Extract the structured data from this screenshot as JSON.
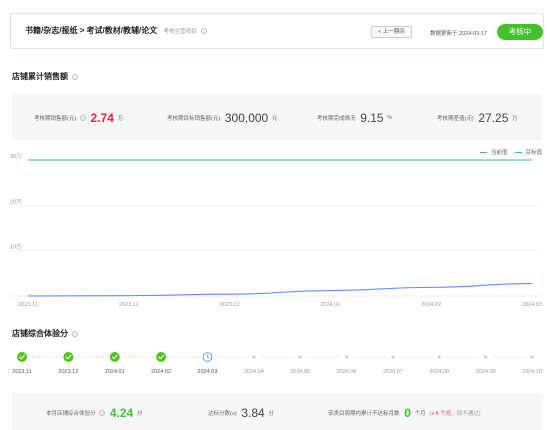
{
  "header": {
    "breadcrumb": "书籍/杂志/报纸 > 考试/教材/教辅/论文",
    "subtitle": "考核主营项目",
    "help_glyph": "?",
    "prev_period": "< 上一期间",
    "update_label": "数据更新于",
    "update_date": "2024-03-17",
    "status": "考核中"
  },
  "sales_section": {
    "title": "店铺累计销售额",
    "kpis": [
      {
        "label": "考核期销售额(元)",
        "value": "2.74",
        "unit": "万"
      },
      {
        "label": "考核期目标销售额(元)",
        "value": "300,000",
        "unit": "元"
      },
      {
        "label": "考核期完成情况",
        "value": "9.15",
        "unit": "%"
      },
      {
        "label": "考核期差值(元)",
        "value": "27.25",
        "unit": "万"
      }
    ],
    "legend": [
      {
        "name": "当前值",
        "color": "#5b8ff9"
      },
      {
        "name": "目标值",
        "color": "#3cc08a"
      }
    ]
  },
  "chart_data": {
    "type": "line",
    "x": [
      "2023.11",
      "2023.11",
      "2023.12",
      "2024.01",
      "2024.02",
      "2024.03"
    ],
    "y_ticks": [
      "10万",
      "20万",
      "30万"
    ],
    "ylim": [
      0,
      300000
    ],
    "series": [
      {
        "name": "当前值",
        "color": "#5b8ff9",
        "values": [
          0,
          800,
          4000,
          12000,
          19000,
          27400
        ]
      },
      {
        "name": "目标值",
        "color": "#3cc08a",
        "values": [
          300000,
          300000,
          300000,
          300000,
          300000,
          300000
        ]
      }
    ],
    "grid": true,
    "legend_position": "top-right"
  },
  "score_section": {
    "title": "店铺综合体验分",
    "timeline": [
      {
        "label": "2023.11",
        "state": "done"
      },
      {
        "label": "2023.12",
        "state": "done"
      },
      {
        "label": "2024.01",
        "state": "done"
      },
      {
        "label": "2024.02",
        "state": "done"
      },
      {
        "label": "2024.03",
        "state": "current"
      },
      {
        "label": "2024.04",
        "state": "future"
      },
      {
        "label": "2024.05",
        "state": "future"
      },
      {
        "label": "2024.06",
        "state": "future"
      },
      {
        "label": "2024.07",
        "state": "future"
      },
      {
        "label": "2024.08",
        "state": "future"
      },
      {
        "label": "2024.09",
        "state": "future"
      },
      {
        "label": "2024.10",
        "state": "future"
      }
    ],
    "colors": {
      "done": "#52c41a",
      "current": "#5b8ff9",
      "future": "#d0d0d0"
    },
    "summary": {
      "score_label": "本月店铺综合体验分",
      "score_value": "4.24",
      "score_unit": "分",
      "pass_label": "达标分数(≥)",
      "pass_value": "3.84",
      "pass_unit": "分",
      "fail_label": "该类目周期内累计不达标月数",
      "fail_value": "0",
      "fail_unit": "个月",
      "fail_note_prefix": "(",
      "fail_note_highlight": "≥ 6 个月",
      "fail_note_suffix": "，即不通过)"
    }
  }
}
